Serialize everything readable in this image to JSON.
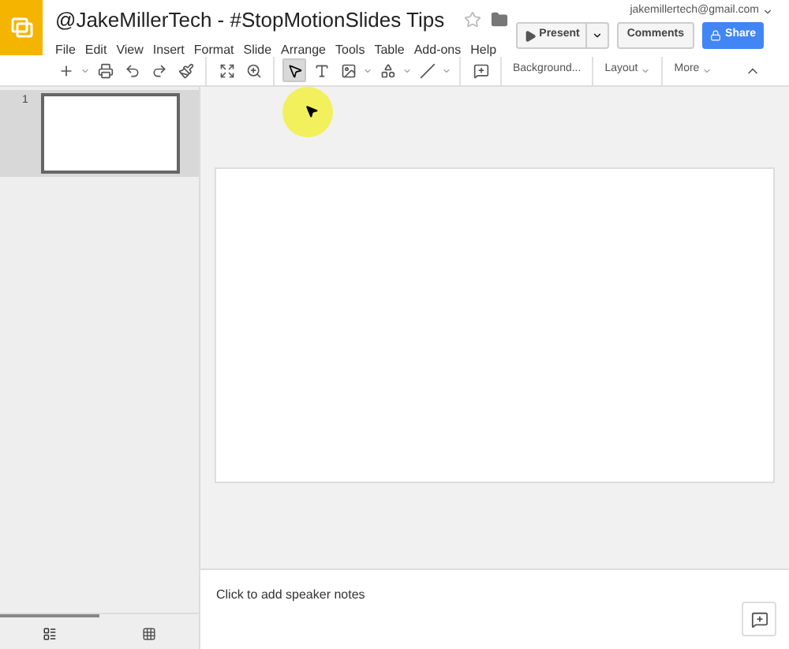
{
  "document": {
    "title": "@JakeMillerTech - #StopMotionSlides Tips",
    "starred": false
  },
  "account": "jakemillertech@gmail.com",
  "menu": [
    "File",
    "Edit",
    "View",
    "Insert",
    "Format",
    "Slide",
    "Arrange",
    "Tools",
    "Table",
    "Add-ons",
    "Help"
  ],
  "buttons": {
    "present": "Present",
    "comments": "Comments",
    "share": "Share"
  },
  "toolbar": [
    {
      "kind": "icon",
      "selected": false
    },
    {
      "kind": "caret"
    },
    {
      "kind": "icon",
      "selected": false
    },
    {
      "kind": "icon",
      "selected": false
    },
    {
      "kind": "icon",
      "selected": false
    },
    {
      "kind": "icon",
      "selected": false
    },
    {
      "kind": "divider"
    },
    {
      "kind": "icon",
      "selected": false
    },
    {
      "kind": "icon",
      "selected": false
    },
    {
      "kind": "divider"
    },
    {
      "kind": "icon",
      "selected": true
    },
    {
      "kind": "icon",
      "selected": false
    },
    {
      "kind": "icon",
      "selected": false
    },
    {
      "kind": "caret"
    },
    {
      "kind": "icon",
      "selected": false
    },
    {
      "kind": "caret"
    },
    {
      "kind": "icon",
      "selected": false
    },
    {
      "kind": "caret"
    },
    {
      "kind": "divider"
    },
    {
      "kind": "icon",
      "selected": false
    },
    {
      "kind": "divider"
    },
    {
      "kind": "text",
      "label": "Background..."
    },
    {
      "kind": "divider"
    },
    {
      "kind": "menu",
      "label": "Layout"
    },
    {
      "kind": "divider"
    },
    {
      "kind": "menu",
      "label": "More"
    }
  ],
  "slides": [
    {
      "number": "1",
      "selected": true
    }
  ],
  "view_modes": [
    {
      "selected": true
    },
    {
      "selected": false
    }
  ],
  "notes": {
    "placeholder": "Click to add speaker notes"
  }
}
